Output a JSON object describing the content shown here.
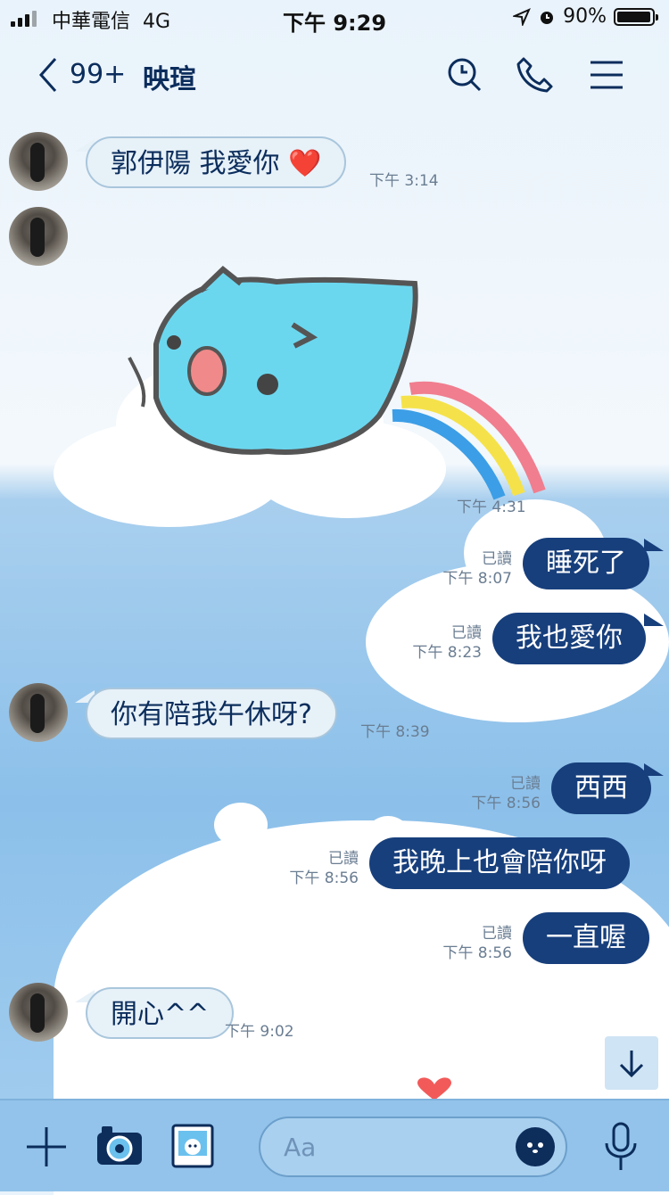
{
  "status_bar": {
    "carrier": "中華電信",
    "network": "4G",
    "time": "下午 9:29",
    "battery": "90%"
  },
  "header": {
    "back_count": "99+",
    "title": "映瑄"
  },
  "messages": [
    {
      "side": "in",
      "text": "郭伊陽 我愛你 ❤️",
      "time": "下午 3:14"
    },
    {
      "side": "in",
      "type": "sticker",
      "time": "下午 4:31"
    },
    {
      "side": "out",
      "text": "睡死了",
      "read": "已讀",
      "time": "下午 8:07"
    },
    {
      "side": "out",
      "text": "我也愛你",
      "read": "已讀",
      "time": "下午 8:23"
    },
    {
      "side": "in",
      "text": "你有陪我午休呀?",
      "time": "下午 8:39"
    },
    {
      "side": "out",
      "text": "西西",
      "read": "已讀",
      "time": "下午 8:56"
    },
    {
      "side": "out",
      "text": "我晚上也會陪你呀",
      "read": "已讀",
      "time": "下午 8:56"
    },
    {
      "side": "out",
      "text": "一直喔",
      "read": "已讀",
      "time": "下午 8:56"
    },
    {
      "side": "in",
      "text": "開心^^",
      "time": "下午 9:02"
    }
  ],
  "input": {
    "placeholder": "Aa"
  },
  "colors": {
    "outgoing_bubble": "#173f7c",
    "incoming_bubble": "#e7f1f8",
    "accent": "#0b2d5c"
  }
}
